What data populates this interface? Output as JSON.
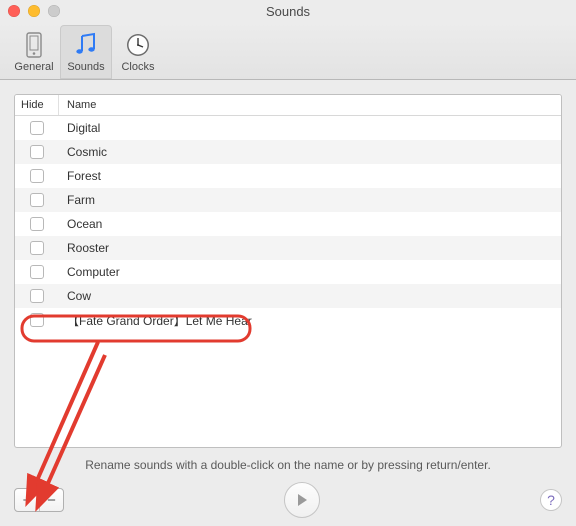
{
  "window": {
    "title": "Sounds"
  },
  "tabs": [
    {
      "id": "general",
      "label": "General"
    },
    {
      "id": "sounds",
      "label": "Sounds"
    },
    {
      "id": "clocks",
      "label": "Clocks"
    }
  ],
  "columns": {
    "hide": "Hide",
    "name": "Name"
  },
  "rows": [
    {
      "name": "Digital"
    },
    {
      "name": "Cosmic"
    },
    {
      "name": "Forest"
    },
    {
      "name": "Farm"
    },
    {
      "name": "Ocean"
    },
    {
      "name": "Rooster"
    },
    {
      "name": "Computer"
    },
    {
      "name": "Cow"
    },
    {
      "name": "【Fate Grand Order】Let Me Hear"
    }
  ],
  "hint": "Rename sounds with a double-click on the name or by pressing return/enter.",
  "buttons": {
    "add": "+",
    "remove": "−",
    "help": "?"
  },
  "annotation_color": "#e23b2f"
}
